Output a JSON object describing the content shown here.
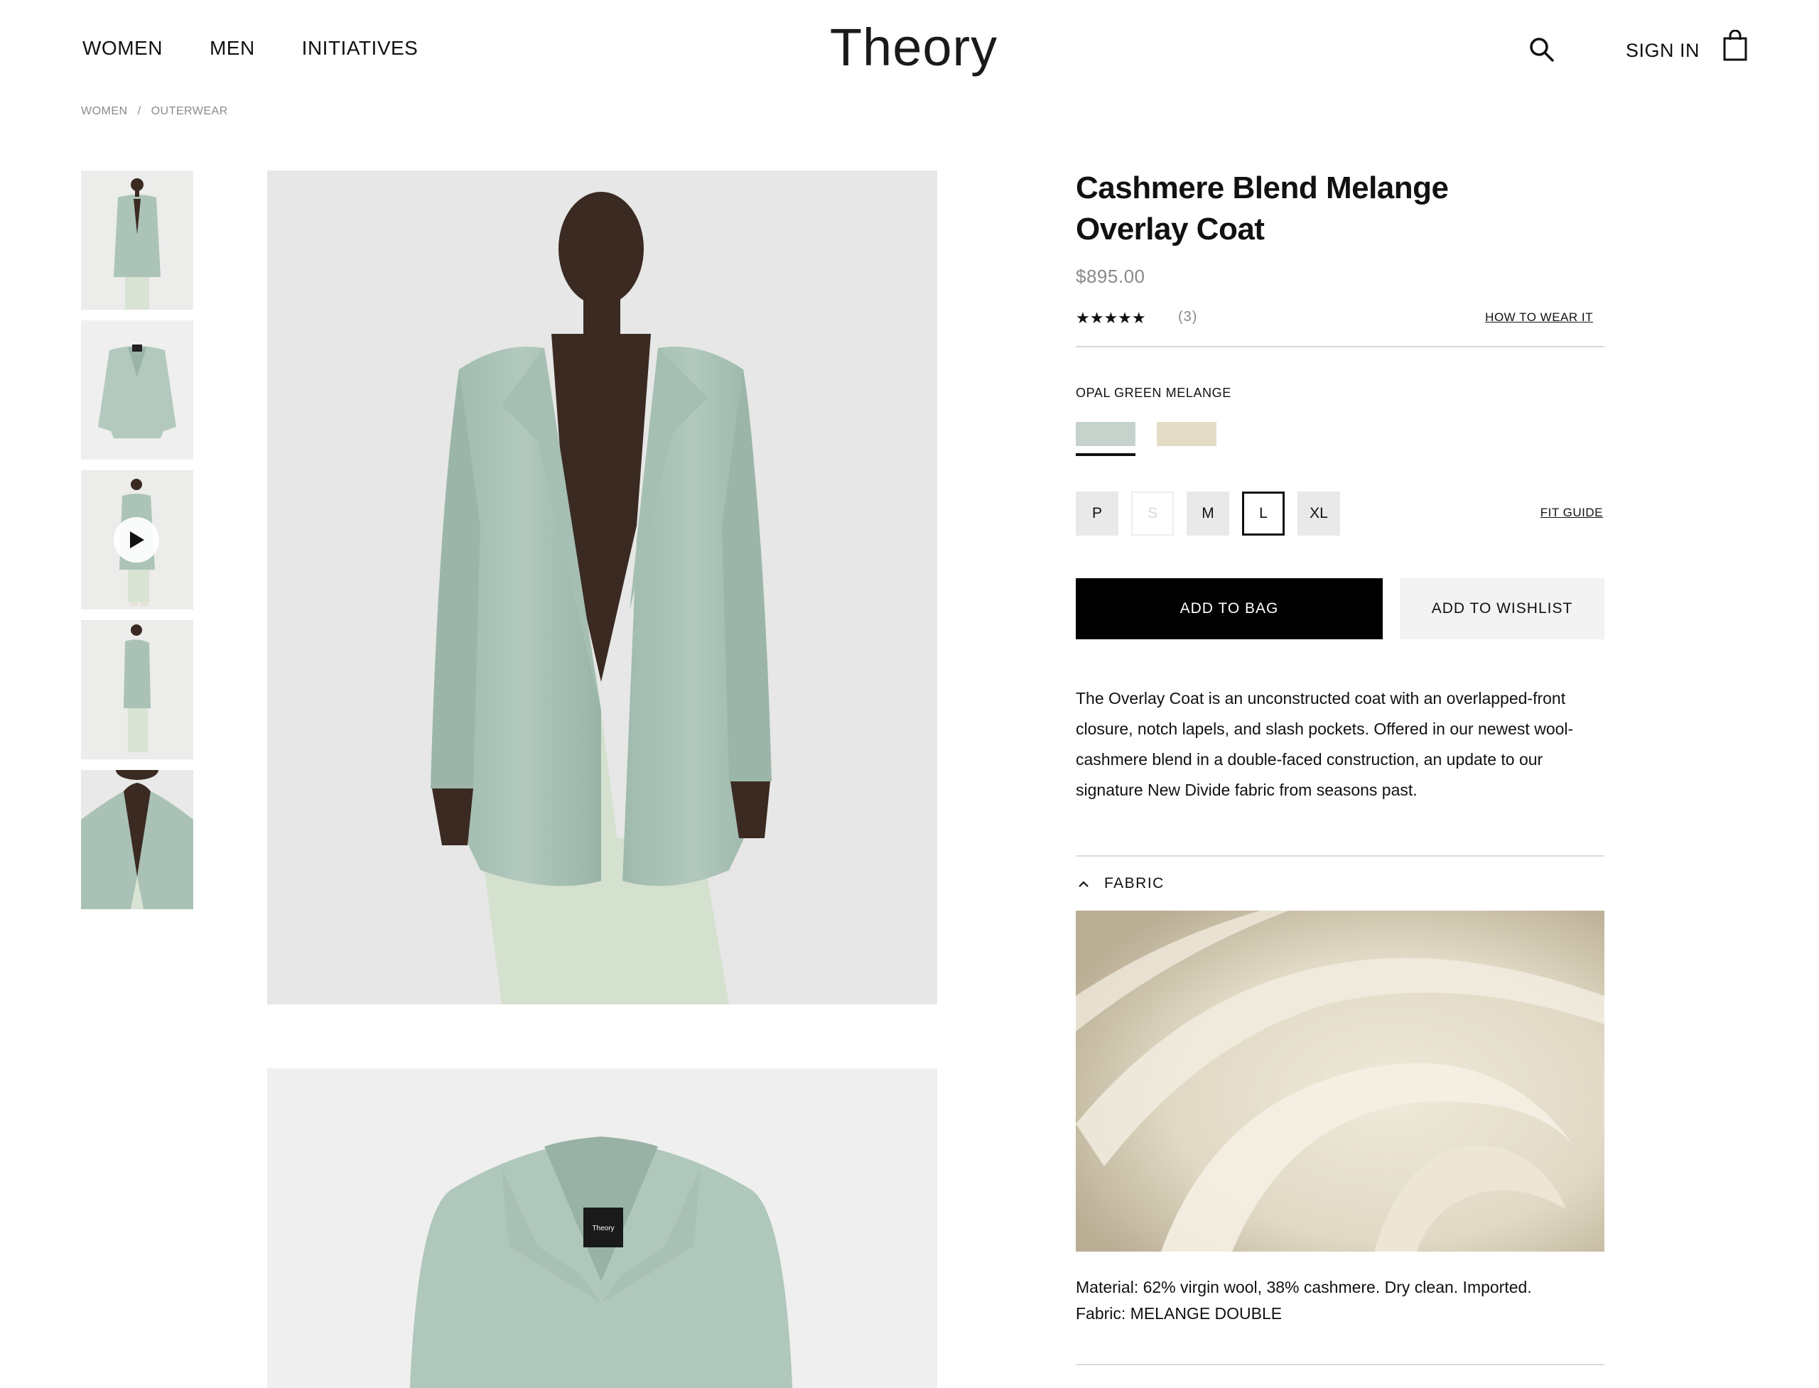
{
  "header": {
    "nav": [
      "WOMEN",
      "MEN",
      "INITIATIVES"
    ],
    "logo": "Theory",
    "sign_in": "SIGN IN"
  },
  "breadcrumb": [
    "WOMEN",
    "/",
    "OUTERWEAR"
  ],
  "product": {
    "title": "Cashmere Blend Melange Overlay Coat",
    "price": "$895.00",
    "rating_stars": "★★★★★",
    "review_count": "(3)",
    "how_to_wear": "HOW TO WEAR IT",
    "color_name": "OPAL GREEN MELANGE",
    "swatches": [
      {
        "name": "opal-green-melange",
        "color": "#c6d3cd",
        "selected": true
      },
      {
        "name": "beige",
        "color": "#e3dcc6",
        "selected": false
      }
    ],
    "sizes": [
      {
        "label": "P",
        "state": "available"
      },
      {
        "label": "S",
        "state": "disabled"
      },
      {
        "label": "M",
        "state": "available"
      },
      {
        "label": "L",
        "state": "selected"
      },
      {
        "label": "XL",
        "state": "available"
      }
    ],
    "fit_guide": "FIT GUIDE",
    "add_to_bag": "ADD TO BAG",
    "add_to_wishlist": "ADD TO WISHLIST",
    "description": "The Overlay Coat is an unconstructed coat with an overlapped-front closure, notch lapels, and slash pockets. Offered in our newest wool-cashmere blend in a double-faced construction, an update to our signature New Divide fabric from seasons past.",
    "fabric_label": "FABRIC",
    "material_line": "Material: 62% virgin wool, 38% cashmere. Dry clean. Imported.",
    "fabric_line": "Fabric: MELANGE DOUBLE",
    "garment_label_text": "Theory"
  },
  "colors": {
    "coat": "#a9c2b5",
    "coat_shadow": "#8fab9d",
    "dress": "#d3dfcd",
    "skin": "#3b2a22",
    "bg_main": "#e7e8e7",
    "fabric": "#ebe6d6"
  },
  "thumbnails": [
    {
      "name": "thumb-front-model"
    },
    {
      "name": "thumb-flat-coat"
    },
    {
      "name": "thumb-video"
    },
    {
      "name": "thumb-side-model"
    },
    {
      "name": "thumb-closeup"
    }
  ]
}
